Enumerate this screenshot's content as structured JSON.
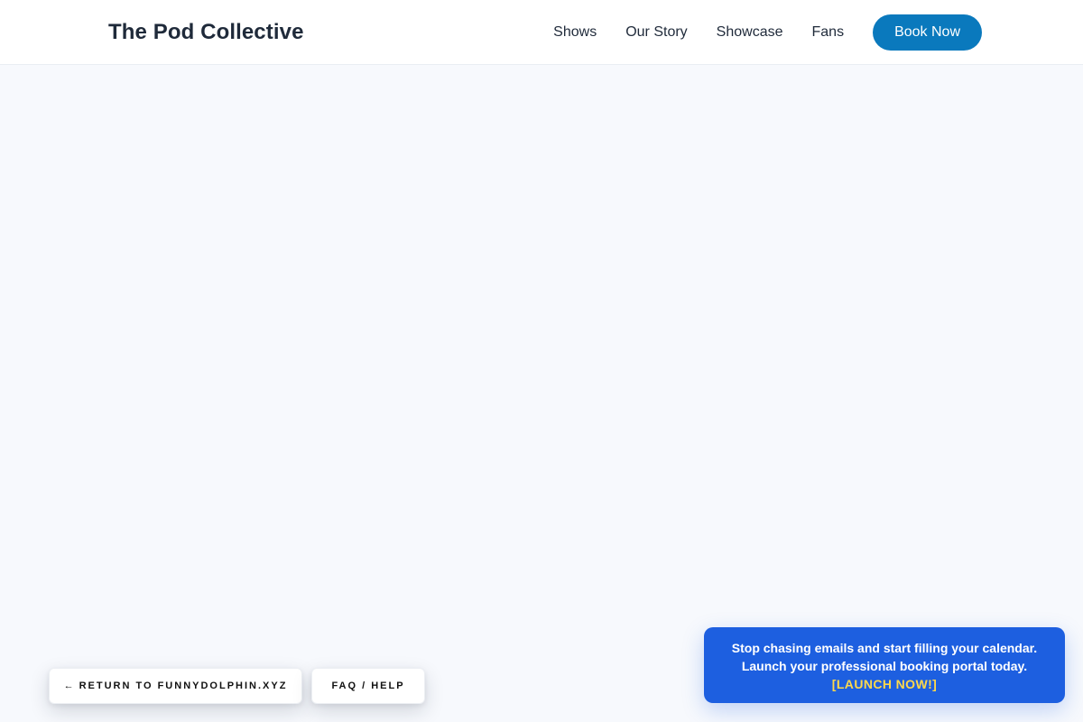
{
  "header": {
    "brand": "The Pod Collective",
    "nav": [
      {
        "label": "Shows"
      },
      {
        "label": "Our Story"
      },
      {
        "label": "Showcase"
      },
      {
        "label": "Fans"
      }
    ],
    "cta_label": "Book Now",
    "cta_color": "#0a79bd"
  },
  "floating": {
    "return_arrow": "←",
    "return_label": "Return to funnydolphin.xyz",
    "faq_label": "FAQ / Help"
  },
  "promo": {
    "line1": "Stop chasing emails and start filling your calendar.",
    "line2": "Launch your professional booking portal today.",
    "link_label": "[LAUNCH NOW!]",
    "background": "#1d5fe0",
    "link_color": "#ffd84a"
  }
}
